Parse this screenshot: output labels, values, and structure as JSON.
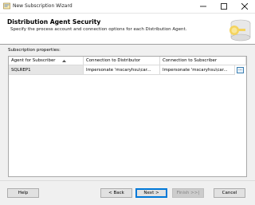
{
  "window": {
    "title": "New Subscription Wizard",
    "controls": [
      "minimize-icon",
      "maximize-icon",
      "close-icon"
    ]
  },
  "header": {
    "title": "Distribution Agent Security",
    "subtitle": "Specify the process account and connection options for each Distribution Agent."
  },
  "properties": {
    "label": "Subscription properties:",
    "columns": [
      "Agent for Subscriber",
      "Connection to Distributor",
      "Connection to Subscriber"
    ],
    "sort_icon": "sort-up-icon",
    "rows": [
      {
        "agent": "SQLREP1",
        "distributor": "Impersonate 'mscaryhsu\\car...",
        "subscriber": "Impersonate 'mscaryhsu\\car...",
        "button": "..."
      }
    ]
  },
  "buttons": {
    "help": "Help",
    "back": "< Back",
    "next": "Next >",
    "finish": "Finish >>|",
    "cancel": "Cancel"
  },
  "colors": {
    "window_bg": "#f0f0f0",
    "header_bg": "#ffffff",
    "selected_row": "#e6e6e6",
    "default_button_border": "#0078d7"
  }
}
